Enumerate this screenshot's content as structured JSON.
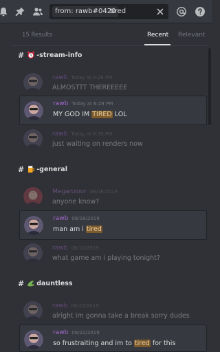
{
  "toolbar": {
    "icons": [
      "bell-icon",
      "pin-icon",
      "members-icon",
      "mention-icon",
      "help-icon"
    ]
  },
  "search": {
    "filter_chip": "from: rawb#0420",
    "term": "tired"
  },
  "results": {
    "count": "15 Results",
    "tabs": [
      {
        "label": "Recent",
        "active": true
      },
      {
        "label": "Relevant",
        "active": false
      }
    ]
  },
  "groups": [
    {
      "channel": "-stream-info",
      "messages": [
        {
          "user": "rawb",
          "time": "Today at 6:28 PM",
          "text": "ALMOSTTT THEREEEEE",
          "role": "context"
        },
        {
          "user": "rawb",
          "time": "Today at 6:29 PM",
          "text_before": "MY GOD IM ",
          "highlight": "TIRED",
          "text_after": " LOL",
          "role": "hit"
        },
        {
          "user": "rawb",
          "time": "Today at 6:30 PM",
          "text": "just waiting on renders now",
          "role": "context"
        }
      ]
    },
    {
      "channel": "-general",
      "messages": [
        {
          "user": "Meganzoor",
          "time": "08/16/2019",
          "text": "anyone know?",
          "role": "context"
        },
        {
          "user": "rawb",
          "time": "08/16/2019",
          "text_before": "man am i ",
          "highlight": "tired",
          "text_after": "",
          "role": "hit"
        },
        {
          "user": "rawb",
          "time": "08/16/2019",
          "text": "what game am i playing tonight?",
          "role": "context"
        }
      ]
    },
    {
      "channel": "dauntless",
      "messages": [
        {
          "user": "rawb",
          "time": "06/22/2019",
          "text": "alright im gonna take a break sorry dudes",
          "role": "context"
        },
        {
          "user": "rawb",
          "time": "06/22/2019",
          "text_before": "so frustraiting and im to ",
          "highlight": "tired",
          "text_after": " for this",
          "role": "hit"
        }
      ]
    }
  ],
  "colors": {
    "background": "#2f3136",
    "card": "#36393f",
    "username": "#a86ad6",
    "highlight": "#7c5a2c"
  }
}
